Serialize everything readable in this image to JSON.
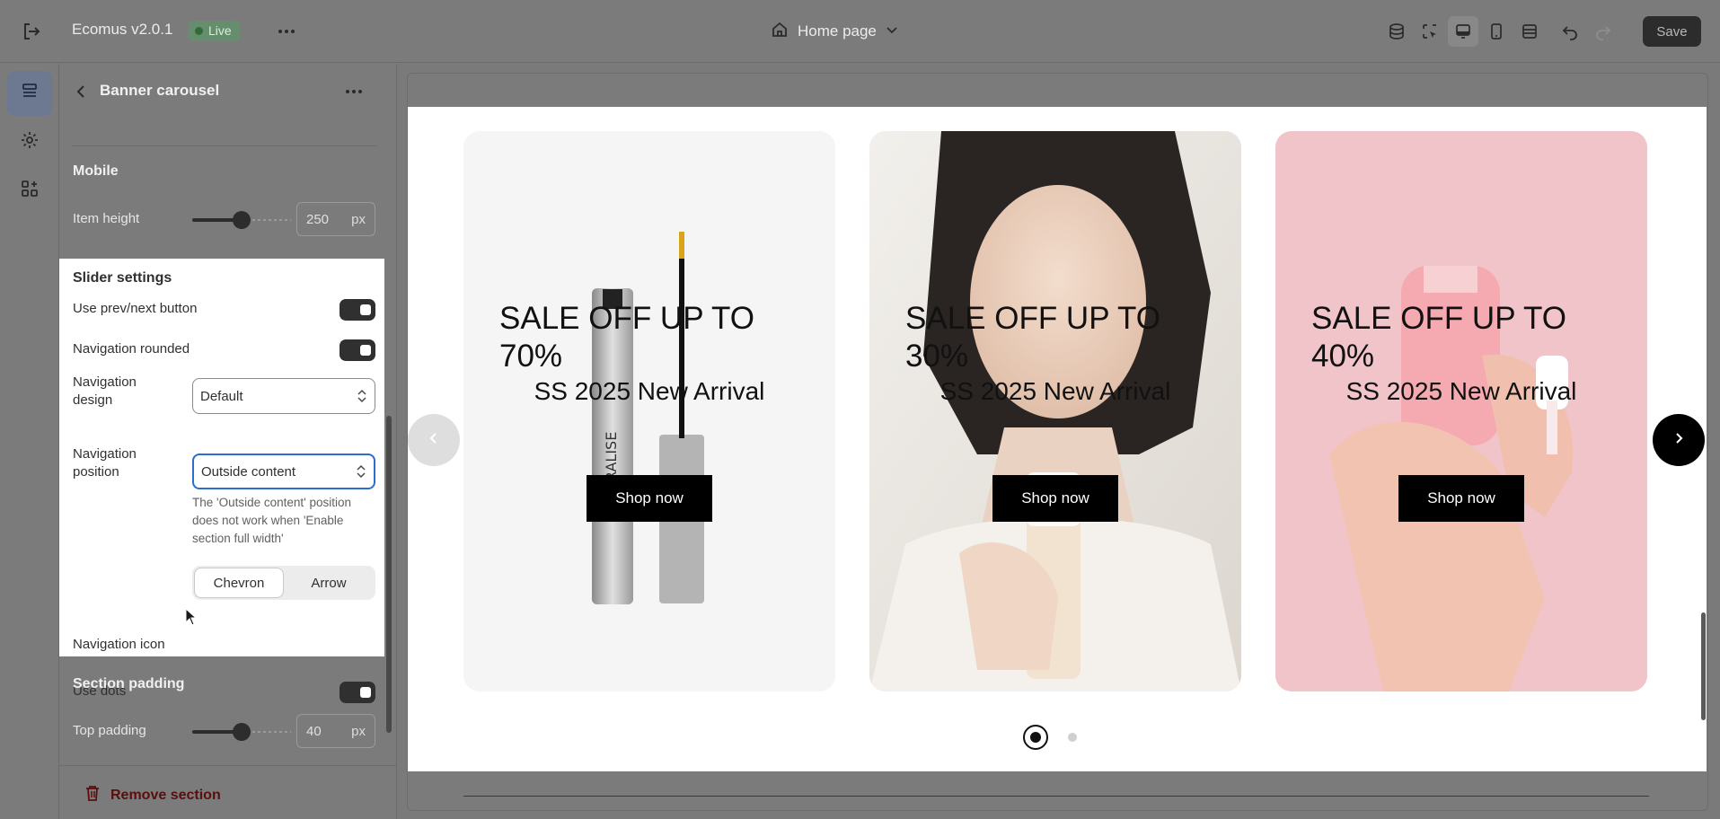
{
  "topbar": {
    "app_name": "Ecomus v2.0.1",
    "status_badge": "Live",
    "page_selector": "Home page",
    "save_label": "Save"
  },
  "panel": {
    "title": "Banner carousel",
    "mobile": {
      "heading": "Mobile",
      "item_height_label": "Item height",
      "item_height_value": "250",
      "item_height_unit": "px",
      "item_height_fraction": 0.5
    },
    "slider_settings": {
      "heading": "Slider settings",
      "use_prev_next_label": "Use prev/next button",
      "use_prev_next_on": true,
      "nav_rounded_label": "Navigation rounded",
      "nav_rounded_on": true,
      "nav_design_label": "Navigation design",
      "nav_design_value": "Default",
      "nav_position_label": "Navigation position",
      "nav_position_value": "Outside content",
      "nav_position_help": "The 'Outside content' position does not work when 'Enable section full width'",
      "nav_icon_label": "Navigation icon",
      "nav_icon_options": [
        "Chevron",
        "Arrow"
      ],
      "nav_icon_selected": "Chevron",
      "use_dots_label": "Use dots",
      "use_dots_on": true
    },
    "section_padding": {
      "heading": "Section padding",
      "top_padding_label": "Top padding",
      "top_padding_value": "40",
      "top_padding_unit": "px",
      "top_padding_fraction": 0.5
    },
    "remove_label": "Remove section"
  },
  "preview": {
    "slides": [
      {
        "title": "SALE OFF UP TO 70%",
        "subtitle": "SS 2025 New Arrival",
        "button": "Shop now",
        "bg": "#f5f5f5"
      },
      {
        "title": "SALE OFF UP TO 30%",
        "subtitle": "SS 2025 New Arrival",
        "button": "Shop now",
        "bg": "#e9e6e1"
      },
      {
        "title": "SALE OFF UP TO 40%",
        "subtitle": "SS 2025 New Arrival",
        "button": "Shop now",
        "bg": "#f0c4c8"
      }
    ],
    "mascara_label": "RALISE",
    "active_dot": 1,
    "dot_count": 2
  },
  "icons": {
    "exit": "exit-icon",
    "more": "more-horizontal-icon",
    "home": "home-icon",
    "chevron_down": "chevron-down-icon"
  }
}
